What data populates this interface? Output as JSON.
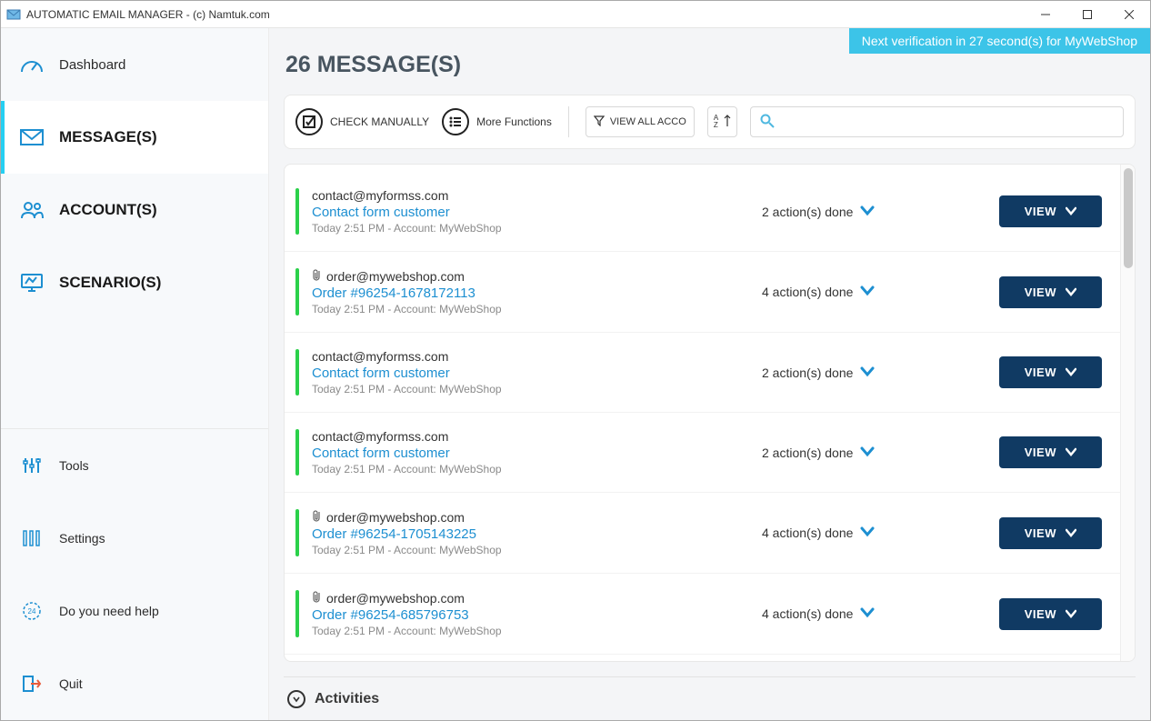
{
  "title": "AUTOMATIC EMAIL MANAGER - (c) Namtuk.com",
  "notification": "Next verification in 27 second(s) for MyWebShop",
  "page_heading": "26 MESSAGE(S)",
  "sidebar": {
    "top": [
      {
        "label": "Dashboard"
      },
      {
        "label": "MESSAGE(S)"
      },
      {
        "label": "ACCOUNT(S)"
      },
      {
        "label": "SCENARIO(S)"
      }
    ],
    "bottom": [
      {
        "label": "Tools"
      },
      {
        "label": "Settings"
      },
      {
        "label": "Do you need help"
      },
      {
        "label": "Quit"
      }
    ]
  },
  "toolbar": {
    "check_manually": "CHECK MANUALLY",
    "more_functions": "More Functions",
    "view_all_accounts": "VIEW ALL ACCO",
    "sort": "A Z",
    "search_placeholder": ""
  },
  "messages": [
    {
      "from": "contact@myformss.com",
      "subject": "Contact form customer",
      "meta": "Today 2:51 PM - Account: MyWebShop",
      "actions": "2 action(s) done",
      "attachment": false
    },
    {
      "from": "order@mywebshop.com",
      "subject": "Order #96254-1678172113",
      "meta": "Today 2:51 PM - Account: MyWebShop",
      "actions": "4 action(s) done",
      "attachment": true
    },
    {
      "from": "contact@myformss.com",
      "subject": "Contact form customer",
      "meta": "Today 2:51 PM - Account: MyWebShop",
      "actions": "2 action(s) done",
      "attachment": false
    },
    {
      "from": "contact@myformss.com",
      "subject": "Contact form customer",
      "meta": "Today 2:51 PM - Account: MyWebShop",
      "actions": "2 action(s) done",
      "attachment": false
    },
    {
      "from": "order@mywebshop.com",
      "subject": "Order #96254-1705143225",
      "meta": "Today 2:51 PM - Account: MyWebShop",
      "actions": "4 action(s) done",
      "attachment": true
    },
    {
      "from": "order@mywebshop.com",
      "subject": "Order #96254-685796753",
      "meta": "Today 2:51 PM - Account: MyWebShop",
      "actions": "4 action(s) done",
      "attachment": true
    }
  ],
  "view_button": "VIEW",
  "activities_label": "Activities"
}
